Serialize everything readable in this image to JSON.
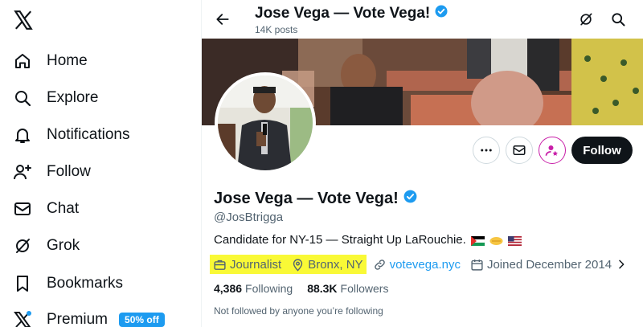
{
  "sidebar": {
    "logo_icon": "x-logo-icon",
    "items": [
      {
        "label": "Home",
        "icon": "home-icon"
      },
      {
        "label": "Explore",
        "icon": "search-icon"
      },
      {
        "label": "Notifications",
        "icon": "bell-icon"
      },
      {
        "label": "Follow",
        "icon": "person-plus-icon"
      },
      {
        "label": "Chat",
        "icon": "envelope-icon"
      },
      {
        "label": "Grok",
        "icon": "grok-icon"
      },
      {
        "label": "Bookmarks",
        "icon": "bookmark-icon"
      },
      {
        "label": "Premium",
        "icon": "x-premium-icon",
        "badge": "50% off"
      }
    ]
  },
  "header": {
    "title": "Jose Vega — Vote Vega!",
    "posts": "14K posts"
  },
  "profile": {
    "name": "Jose Vega — Vote Vega!",
    "handle": "@JosBtrigga",
    "bio": "Candidate for NY-15 — Straight Up LaRouchie.",
    "bio_emoji": [
      "palestine-flag",
      "handshake",
      "us-flag"
    ],
    "occupation": "Journalist",
    "location": "Bronx, NY",
    "website": "votevega.nyc",
    "joined": "Joined December 2014",
    "following_count": "4,386",
    "following_label": "Following",
    "followers_count": "88.3K",
    "followers_label": "Followers",
    "followed_by_note": "Not followed by anyone you’re following",
    "follow_button": "Follow"
  },
  "colors": {
    "accent": "#1d9bf0",
    "text": "#0f1419",
    "muted": "#536471",
    "highlight": "#f9f936",
    "subscribe_pink": "#c81fa8"
  }
}
